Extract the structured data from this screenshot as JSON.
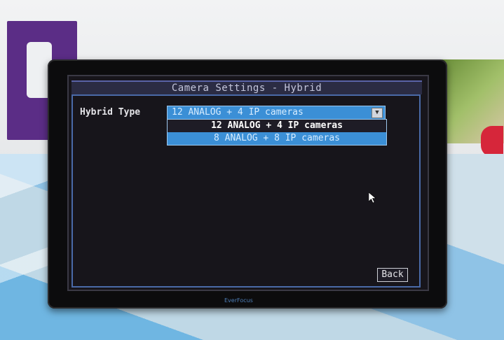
{
  "osd": {
    "title": "Camera Settings - Hybrid",
    "hybrid_type": {
      "label": "Hybrid Type",
      "selected": "12 ANALOG + 4 IP cameras",
      "options": [
        "12 ANALOG + 4 IP cameras",
        "8 ANALOG + 8 IP cameras"
      ]
    },
    "back_label": "Back"
  },
  "monitor": {
    "brand": "EverFocus"
  },
  "colors": {
    "select_blue": "#3b8fd6",
    "screen_bg": "#17151b"
  },
  "icons": {
    "dropdown": "chevron-down-icon",
    "cursor": "mouse-pointer-icon"
  }
}
